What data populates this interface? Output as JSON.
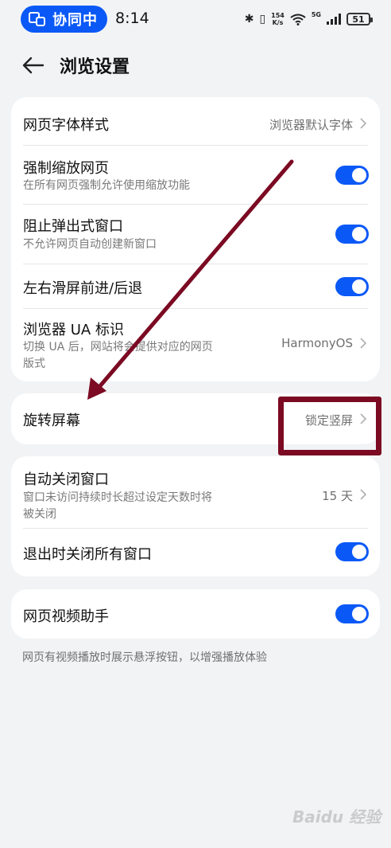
{
  "status_bar": {
    "collab_label": "协同中",
    "time": "8:14",
    "net_speed_value": "154",
    "net_speed_unit": "K/s",
    "network_type": "5G",
    "battery": "51"
  },
  "header": {
    "title": "浏览设置"
  },
  "group1": {
    "font_style": {
      "title": "网页字体样式",
      "value": "浏览器默认字体"
    },
    "force_zoom": {
      "title": "强制缩放网页",
      "subtitle": "在所有网页强制允许使用缩放功能",
      "enabled": true
    },
    "block_popups": {
      "title": "阻止弹出式窗口",
      "subtitle": "不允许网页自动创建新窗口",
      "enabled": true
    },
    "swipe_nav": {
      "title": "左右滑屏前进/后退",
      "enabled": true
    },
    "ua": {
      "title": "浏览器 UA 标识",
      "subtitle_line1": "切换 UA 后，网站将会提供对应的网页",
      "subtitle_line2": "版式",
      "value": "HarmonyOS"
    }
  },
  "group2": {
    "rotate": {
      "title": "旋转屏幕",
      "value": "锁定竖屏"
    }
  },
  "group3": {
    "auto_close": {
      "title": "自动关闭窗口",
      "subtitle_line1": "窗口未访问持续时长超过设定天数时将",
      "subtitle_line2": "被关闭",
      "value": "15 天"
    },
    "close_on_exit": {
      "title": "退出时关闭所有窗口",
      "enabled": true
    }
  },
  "group4": {
    "video_helper": {
      "title": "网页视频助手",
      "enabled": true
    },
    "note": "网页有视频播放时展示悬浮按钮，以增强播放体验"
  },
  "watermark": "Baidu 经验",
  "colors": {
    "accent": "#0a59f7",
    "annotation": "#7b0a22",
    "background": "#f1f3f5"
  }
}
